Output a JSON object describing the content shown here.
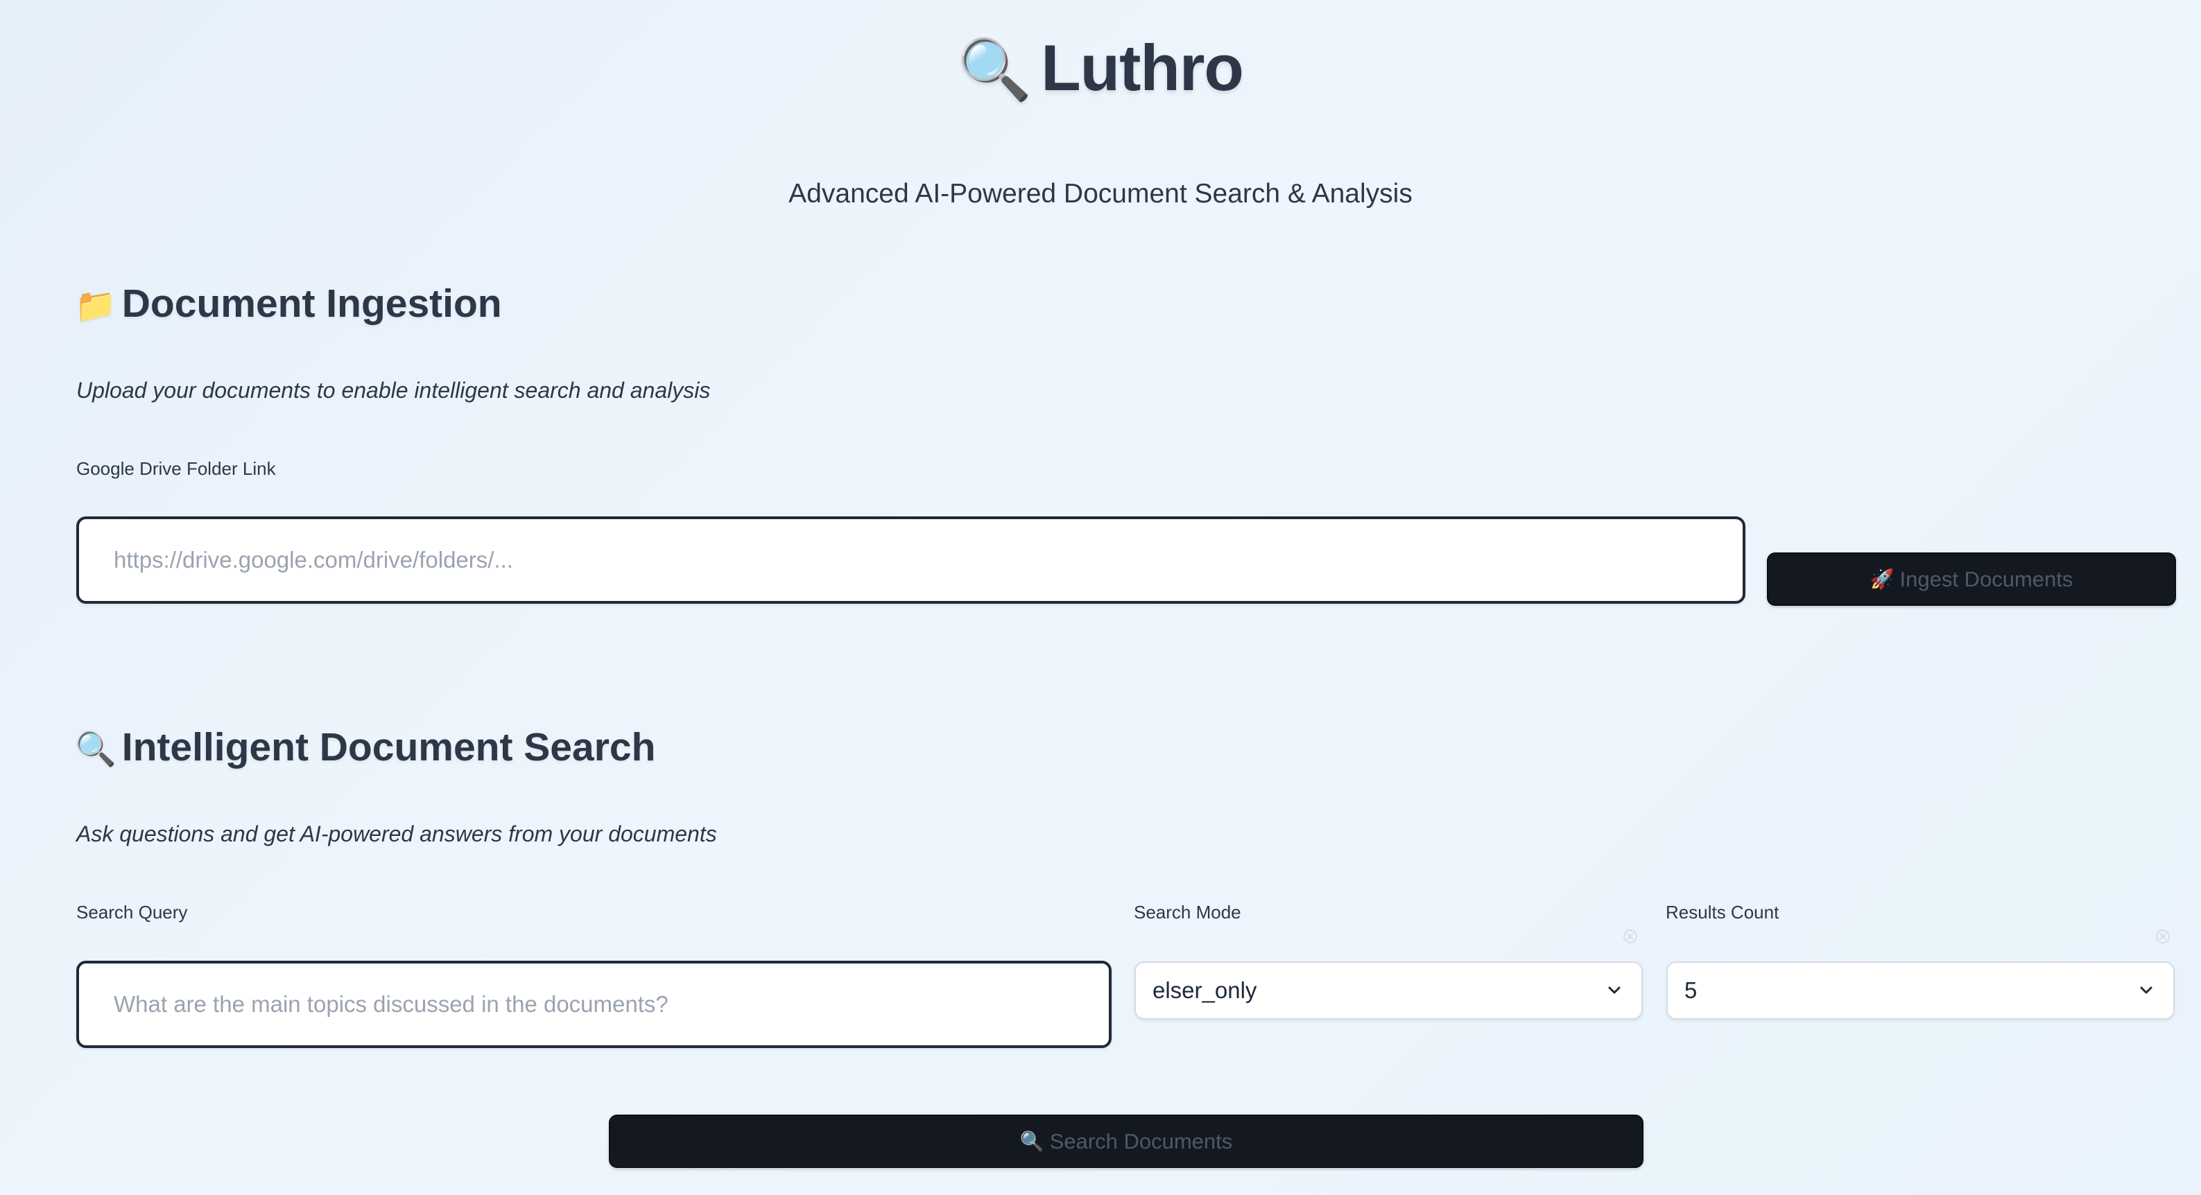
{
  "header": {
    "title": "Luthro",
    "title_icon": "magnifier-icon",
    "subtitle": "Advanced AI-Powered Document Search & Analysis"
  },
  "ingestion": {
    "heading": "Document Ingestion",
    "heading_icon": "folder-icon",
    "description": "Upload your documents to enable intelligent search and analysis",
    "drive_label": "Google Drive Folder Link",
    "drive_placeholder": "https://drive.google.com/drive/folders/...",
    "drive_value": "",
    "ingest_button_label": "Ingest Documents",
    "ingest_button_icon": "rocket-icon"
  },
  "search": {
    "heading": "Intelligent Document Search",
    "heading_icon": "magnifier-icon",
    "description": "Ask questions and get AI-powered answers from your documents",
    "query_label": "Search Query",
    "query_placeholder": "What are the main topics discussed in the documents?",
    "query_value": "",
    "mode_label": "Search Mode",
    "mode_value": "elser_only",
    "count_label": "Results Count",
    "count_value": "5",
    "search_button_label": "Search Documents",
    "search_button_icon": "magnifier-icon"
  },
  "colors": {
    "background": "#e9f2fb",
    "text": "#2d3748",
    "button_dark": "#141820",
    "input_border": "#1f2937"
  }
}
